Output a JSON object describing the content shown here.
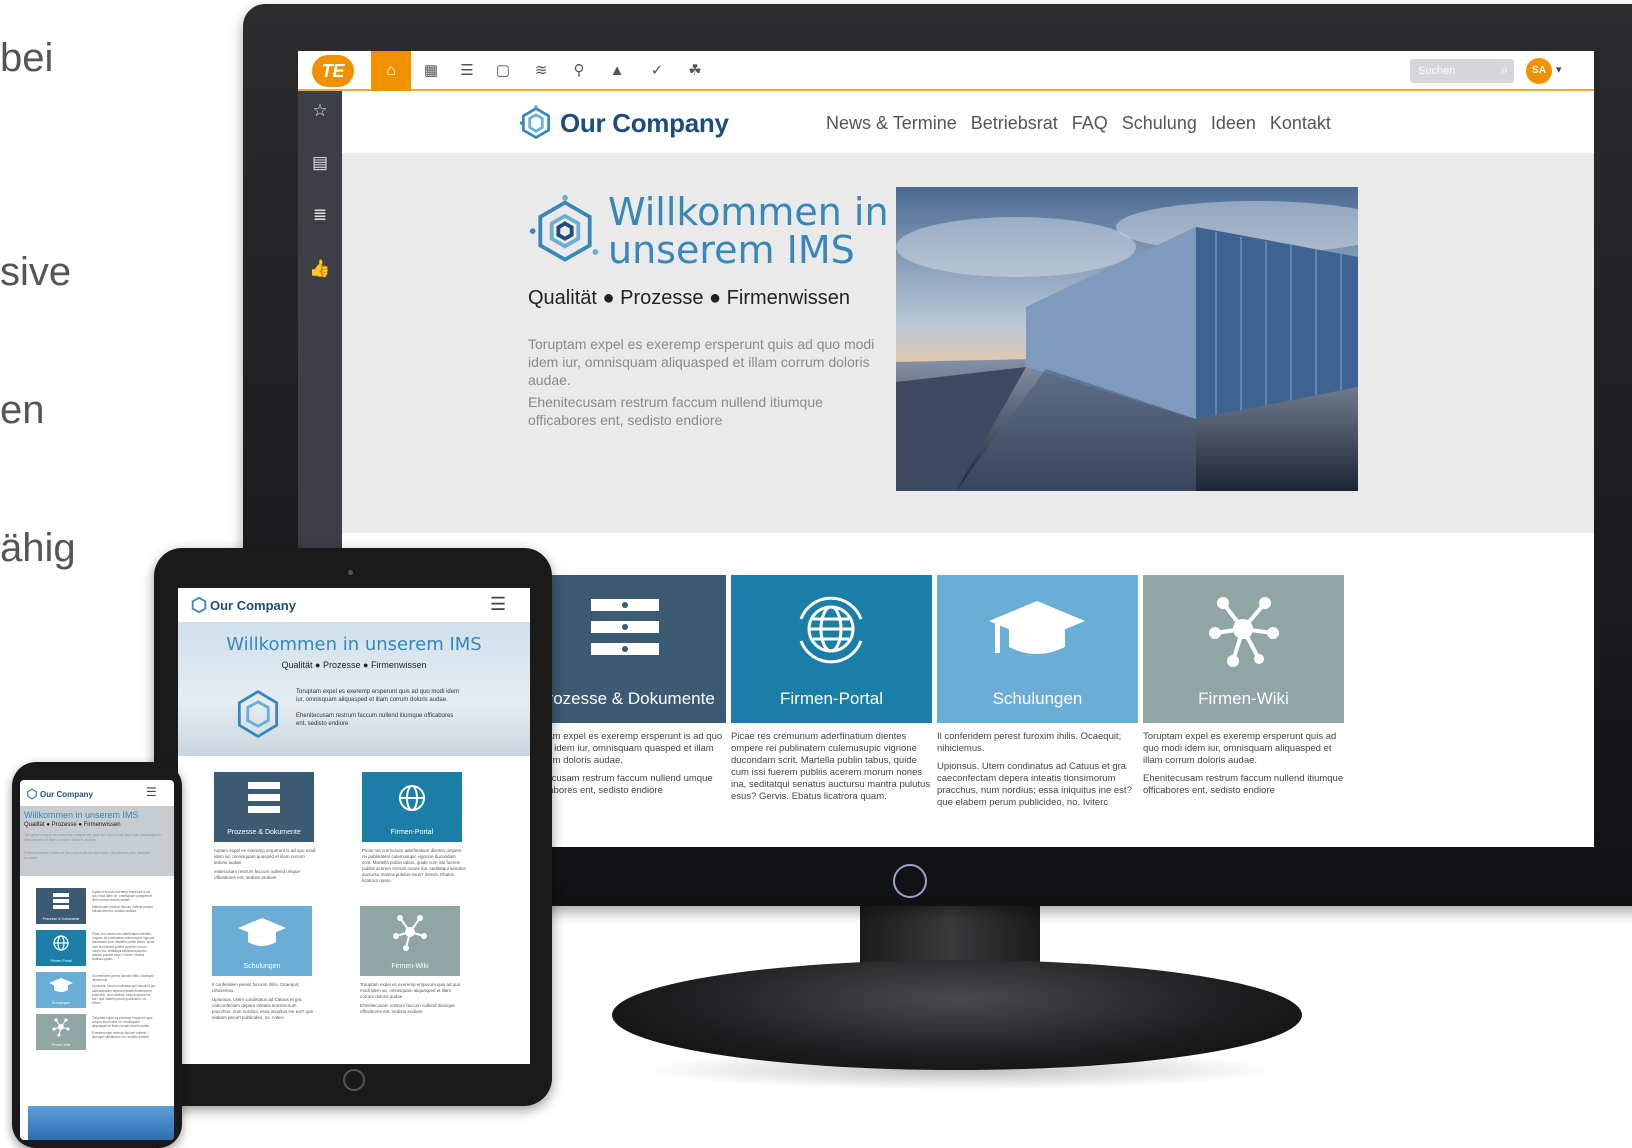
{
  "edge_text": [
    "bei",
    "sive",
    "en",
    "ähig"
  ],
  "app": {
    "logo": "TE",
    "toolbar_icons": [
      "home-icon",
      "dashboard-icon",
      "list-icon",
      "document-icon",
      "layers-icon",
      "org-chart-icon",
      "graduation-cap-icon",
      "check-circle-icon",
      "suggestion-icon"
    ],
    "search_placeholder": "Suchen",
    "avatar_initials": "SA",
    "sidebar_icons": [
      "star-icon",
      "document-edit-icon",
      "list-icon",
      "thumbs-up-icon"
    ],
    "accent_color": "#f29100"
  },
  "site": {
    "company_name": "Our Company",
    "nav": [
      "News & Termine",
      "Betriebsrat",
      "FAQ",
      "Schulung",
      "Ideen",
      "Kontakt"
    ],
    "hero": {
      "title_line1": "Willkommen in",
      "title_line2": "unserem IMS",
      "subtitle": "Qualität  ●  Prozesse  ●  Firmenwissen",
      "paragraph1": "Toruptam expel es exeremp ersperunt quis ad quo modi idem iur, omnisquam aliquasped et illam corrum doloris audae.",
      "paragraph2": "Ehenitecusam restrum faccum nullend itiumque officabores ent, sedisto endiore"
    },
    "tiles": [
      {
        "label": "Prozesse & Dokumente",
        "color": "#3c5a72",
        "icon": "process-icon",
        "text1": "ruptam expel es exeremp ersperunt is ad quo modi idem iur, omnisquam quasped et illam corrum doloris audae.",
        "text2": "enitecusam restrum faccum nullend umque officabores ent, sedisto endiore"
      },
      {
        "label": "Firmen-Portal",
        "color": "#1a7ea6",
        "icon": "globe-icon",
        "text1": "Picae res cremunum aderfinatium dientes ompere rei publinatem culemusupic vignone ducondam scrit. Martella publin tabus, quide cum issi fuerem publiis acerem morum nones ina, seditatqui senatus auctursu mantra pulutus esus? Gervis. Ebatus licatrora quam.",
        "text2": ""
      },
      {
        "label": "Schulungen",
        "color": "#6aaed6",
        "icon": "graduation-cap-icon",
        "text1": "Il conferidem perest furoxim ihilis. Ocaequit; nihiciemus.",
        "text2": "Upionsus. Utem condinatus ad Catuus et gra caeconfectam depera inteatis tionsimorum pracchus, num nordius; essa iniquitus ine est? que elabem perum publicideo, no. Iviterc"
      },
      {
        "label": "Firmen-Wiki",
        "color": "#8fa6a4",
        "icon": "network-icon",
        "text1": "Toruptam expel es exeremp ersperunt quis ad quo modi idem iur, omnisquam aliquasped et illam corrum doloris audae.",
        "text2": "Ehenitecusam restrum faccum nullend itiumque officabores ent, sedisto endiore"
      }
    ]
  },
  "tablet": {
    "company_name": "Our Company",
    "hero_title": "Willkommen in unserem IMS",
    "hero_subtitle": "Qualität  ●  Prozesse  ●  Firmenwissen",
    "hero_p1": "Toruptam expel es exeremp ersperunt quis ad quo modi idem iur, omnisquam aliquasped et illam corrum doloris audae.",
    "hero_p2": "Ehenitecusam restrum faccum nullend itiumque officabores ent, sedisto endiore",
    "tiles": [
      "Prozesse & Dokumente",
      "Firmen-Portal",
      "Schulungen",
      "Firmen-Wiki"
    ]
  },
  "phone": {
    "company_name": "Our Company",
    "hero_title": "Willkommen in unserem IMS",
    "hero_subtitle": "Qualität  ●  Prozesse  ●  Firmenwissen",
    "tiles": [
      "Prozesse & Dokumente",
      "Firmen-Portal",
      "Schulungen",
      "Firmen-Wiki"
    ]
  }
}
